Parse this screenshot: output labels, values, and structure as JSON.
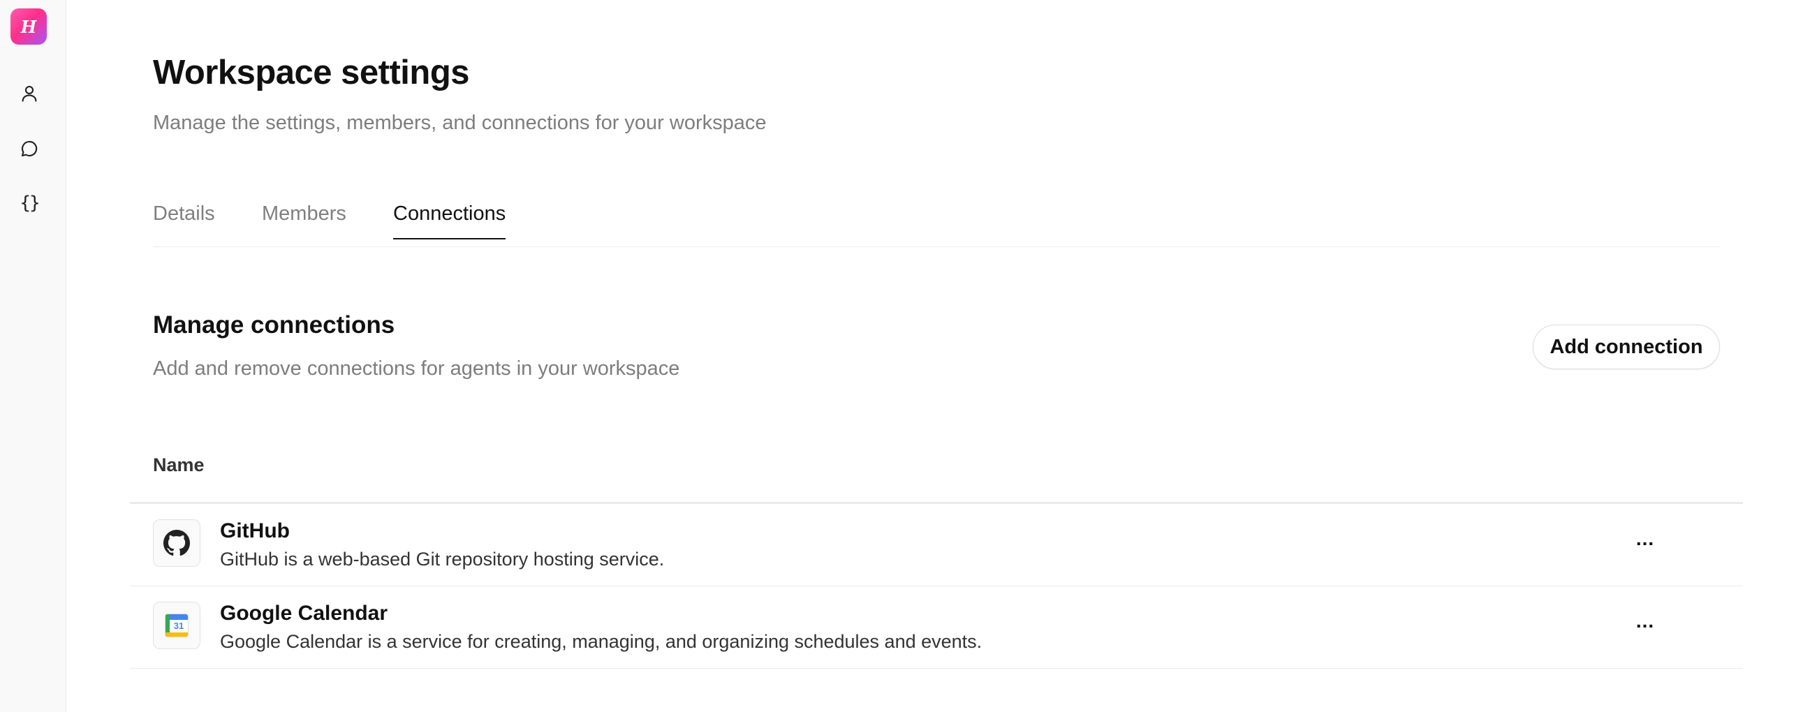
{
  "app": {
    "logo_letter": "H",
    "accent": "#ff2f8a"
  },
  "rail": {
    "items": [
      {
        "icon": "user-icon"
      },
      {
        "icon": "chat-icon"
      },
      {
        "icon": "code-braces-icon",
        "glyph": "{}"
      }
    ]
  },
  "header": {
    "title": "Workspace settings",
    "subtitle": "Manage the settings, members, and connections for your workspace"
  },
  "tabs": [
    {
      "label": "Details",
      "active": false
    },
    {
      "label": "Members",
      "active": false
    },
    {
      "label": "Connections",
      "active": true
    }
  ],
  "connections": {
    "title": "Manage connections",
    "subtitle": "Add and remove connections for agents in your workspace",
    "add_button": "Add connection",
    "column_name": "Name",
    "rows": [
      {
        "name": "GitHub",
        "description": "GitHub is a web-based Git repository hosting service.",
        "icon": "github-icon",
        "more": "..."
      },
      {
        "name": "Google Calendar",
        "description": "Google Calendar is a service for creating, managing, and organizing schedules and events.",
        "icon": "google-calendar-icon",
        "icon_text": "31",
        "more": "..."
      }
    ]
  }
}
